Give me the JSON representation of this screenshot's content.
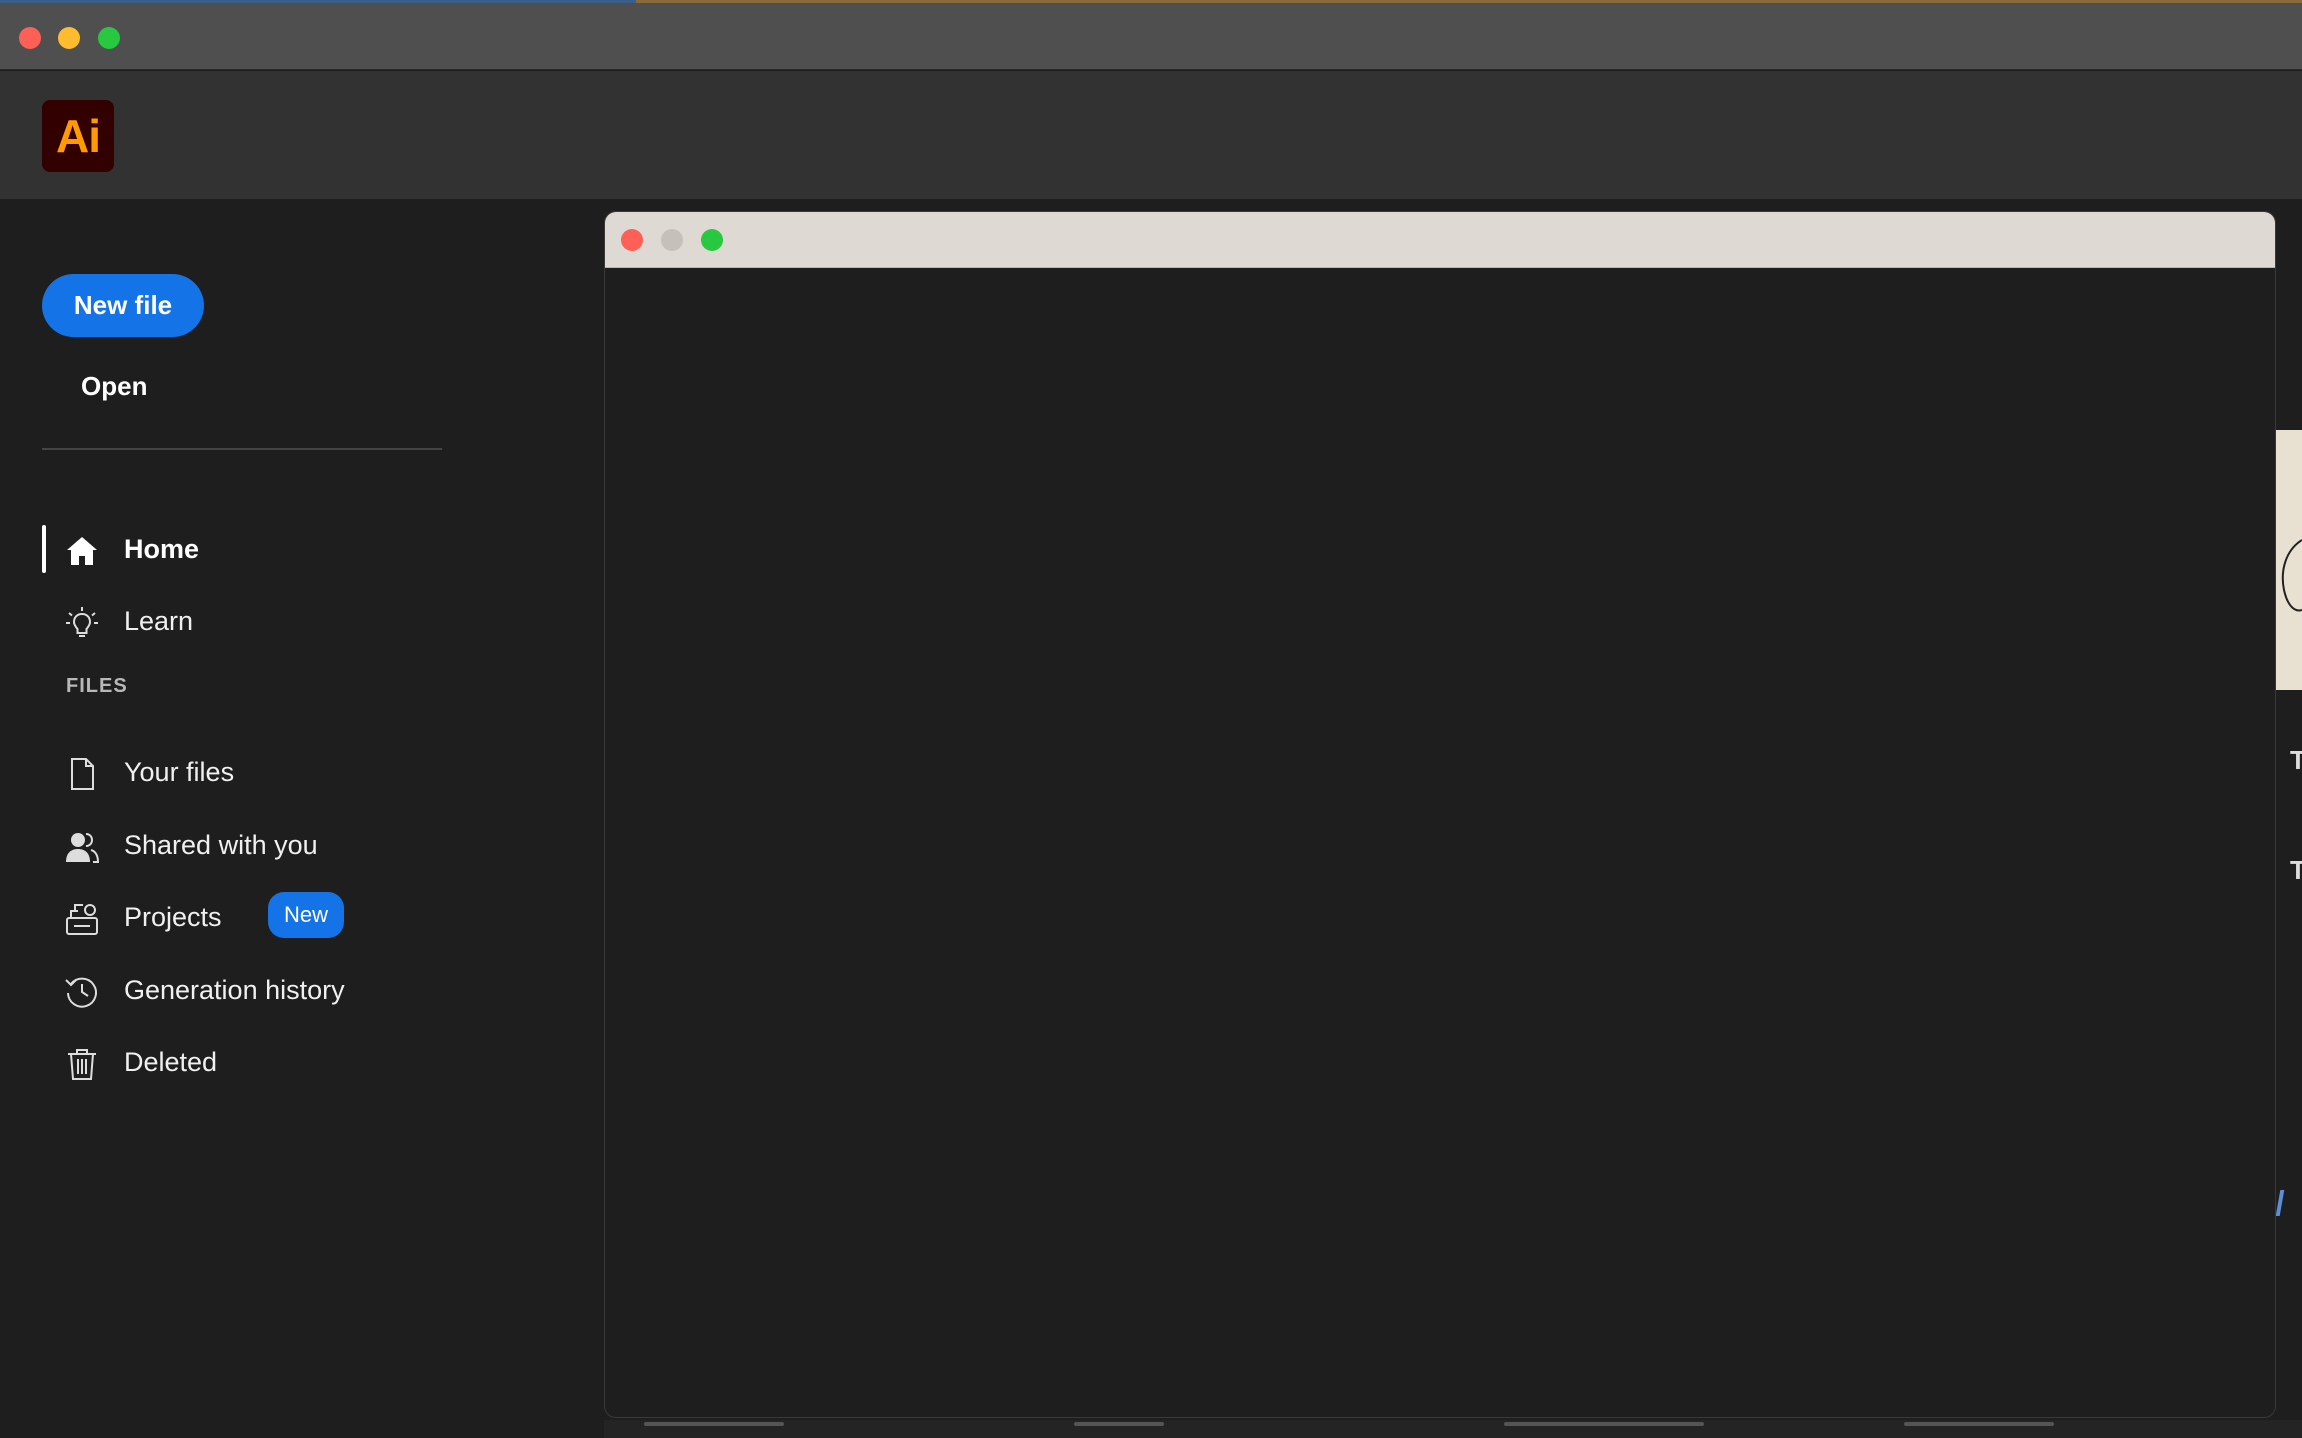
{
  "app": {
    "logo_text": "Ai",
    "accent_color": "#1473e6",
    "logo_bg": "#330000",
    "logo_fg": "#ff9a00"
  },
  "sidebar": {
    "new_file_label": "New file",
    "open_label": "Open",
    "nav": [
      {
        "label": "Home",
        "icon": "home-icon",
        "active": true
      },
      {
        "label": "Learn",
        "icon": "lightbulb-icon",
        "active": false
      }
    ],
    "files_section_label": "FILES",
    "files": [
      {
        "label": "Your files",
        "icon": "file-icon"
      },
      {
        "label": "Shared with you",
        "icon": "shared-users-icon"
      },
      {
        "label": "Projects",
        "icon": "projects-icon",
        "badge": "New"
      },
      {
        "label": "Generation history",
        "icon": "history-icon"
      },
      {
        "label": "Deleted",
        "icon": "trash-icon"
      }
    ]
  },
  "background": {
    "edge_text_1": "T",
    "edge_text_2": "T"
  }
}
